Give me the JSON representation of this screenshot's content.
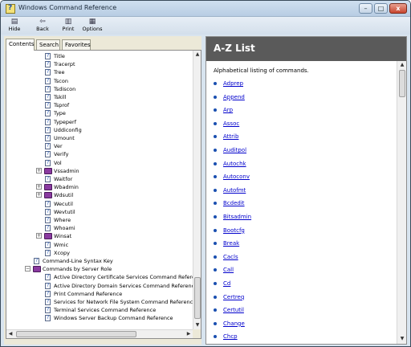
{
  "window": {
    "title": "Windows Command Reference",
    "minimize_glyph": "–",
    "maximize_glyph": "□",
    "close_glyph": "x"
  },
  "toolbar": {
    "hide_label": "Hide",
    "back_label": "Back",
    "print_label": "Print",
    "options_label": "Options"
  },
  "tabs": {
    "contents": "Contents",
    "search": "Search",
    "favorites": "Favorites"
  },
  "tree": {
    "items": [
      {
        "label": "Title",
        "kind": "page",
        "expander": ""
      },
      {
        "label": "Tracerpt",
        "kind": "page",
        "expander": ""
      },
      {
        "label": "Tree",
        "kind": "page",
        "expander": ""
      },
      {
        "label": "Tscon",
        "kind": "page",
        "expander": ""
      },
      {
        "label": "Tsdiscon",
        "kind": "page",
        "expander": ""
      },
      {
        "label": "Tskill",
        "kind": "page",
        "expander": ""
      },
      {
        "label": "Tsprof",
        "kind": "page",
        "expander": ""
      },
      {
        "label": "Type",
        "kind": "page",
        "expander": ""
      },
      {
        "label": "Typeperf",
        "kind": "page",
        "expander": ""
      },
      {
        "label": "Uddiconfig",
        "kind": "page",
        "expander": ""
      },
      {
        "label": "Umount",
        "kind": "page",
        "expander": ""
      },
      {
        "label": "Ver",
        "kind": "page",
        "expander": ""
      },
      {
        "label": "Verify",
        "kind": "page",
        "expander": ""
      },
      {
        "label": "Vol",
        "kind": "page",
        "expander": ""
      },
      {
        "label": "Vssadmin",
        "kind": "book",
        "expander": "+"
      },
      {
        "label": "Waitfor",
        "kind": "page",
        "expander": ""
      },
      {
        "label": "Wbadmin",
        "kind": "book",
        "expander": "+"
      },
      {
        "label": "Wdsutil",
        "kind": "book",
        "expander": "+"
      },
      {
        "label": "Wecutil",
        "kind": "page",
        "expander": ""
      },
      {
        "label": "Wevtutil",
        "kind": "page",
        "expander": ""
      },
      {
        "label": "Where",
        "kind": "page",
        "expander": ""
      },
      {
        "label": "Whoami",
        "kind": "page",
        "expander": ""
      },
      {
        "label": "Winsat",
        "kind": "book",
        "expander": "+"
      },
      {
        "label": "Wmic",
        "kind": "page",
        "expander": ""
      },
      {
        "label": "Xcopy",
        "kind": "page",
        "expander": ""
      }
    ],
    "level1_items": [
      {
        "label": "Command-Line Syntax Key",
        "kind": "page",
        "expander": ""
      },
      {
        "label": "Commands by Server Role",
        "kind": "book-open",
        "expander": "−"
      }
    ],
    "server_role_items": [
      {
        "label": "Active Directory Certificate Services Command Reference"
      },
      {
        "label": "Active Directory Domain Services Command Reference"
      },
      {
        "label": "Print Command Reference"
      },
      {
        "label": "Services for Network File System Command Reference"
      },
      {
        "label": "Terminal Services Command Reference"
      },
      {
        "label": "Windows Server Backup Command Reference"
      }
    ],
    "scroll_up": "▲",
    "scroll_down": "▼",
    "scroll_left": "◀",
    "scroll_right": "▶"
  },
  "content": {
    "header": "A-Z List",
    "subtitle": "Alphabetical listing of commands.",
    "commands": [
      "Adprep",
      "Append",
      "Arp",
      "Assoc",
      "Attrib",
      "Auditpol",
      "Autochk",
      "Autoconv",
      "Autofmt",
      "Bcdedit",
      "Bitsadmin",
      "Bootcfg",
      "Break",
      "Cacls",
      "Call",
      "Cd",
      "Certreq",
      "Certutil",
      "Change",
      "Chcp"
    ]
  },
  "colors": {
    "link": "#0000cc",
    "header_band": "#5a5a5a",
    "book": "#8a3aa0"
  }
}
